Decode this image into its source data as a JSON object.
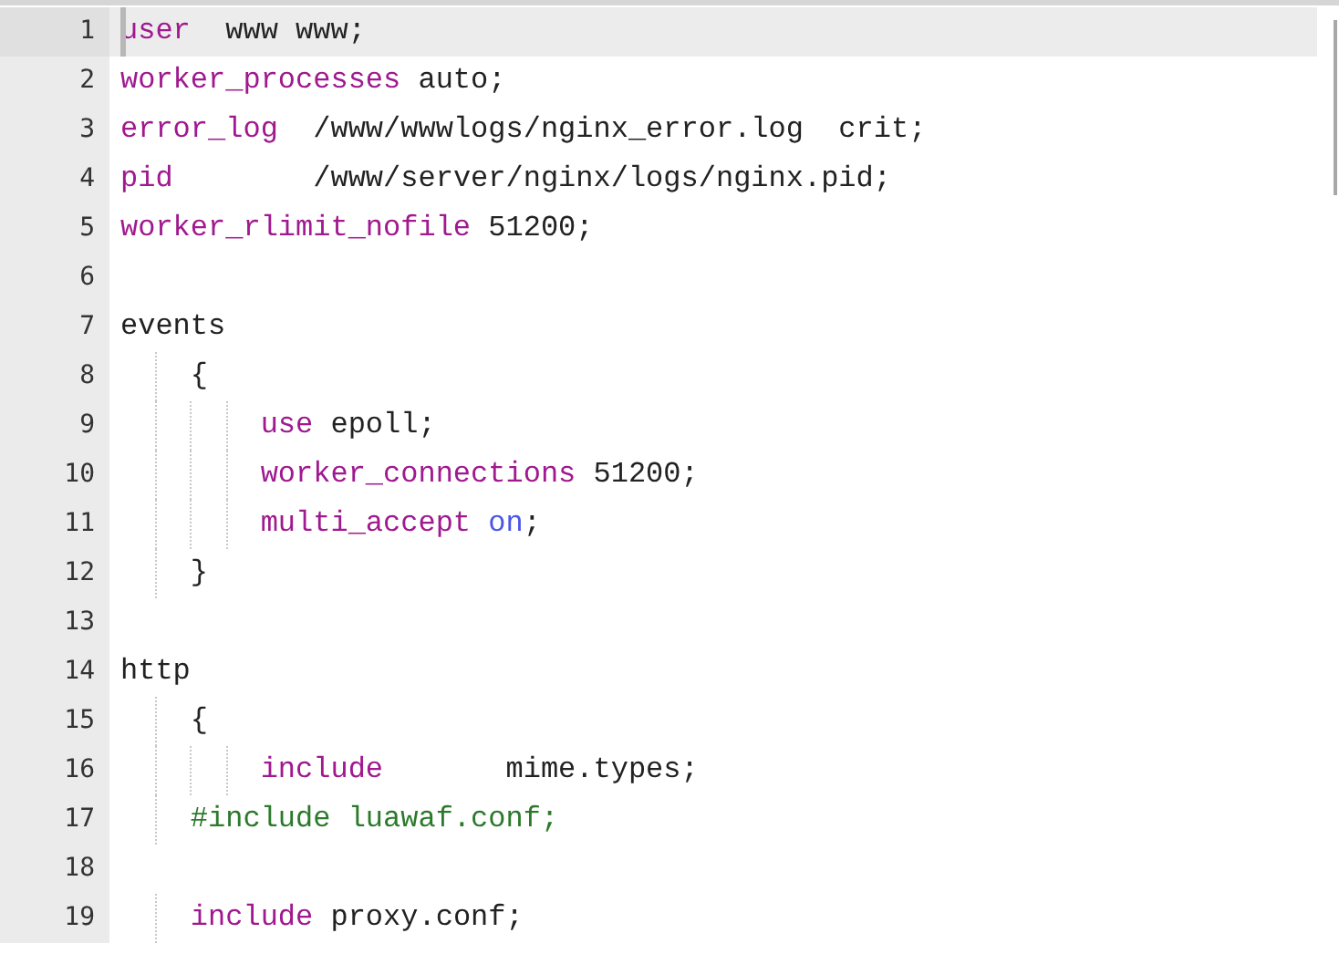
{
  "editor": {
    "lines": [
      {
        "number": "1",
        "selected": true,
        "tokens": [
          {
            "kind": "keyword",
            "text": "user"
          },
          {
            "kind": "plain",
            "text": "  www www;"
          }
        ]
      },
      {
        "number": "2",
        "selected": false,
        "tokens": [
          {
            "kind": "keyword",
            "text": "worker_processes"
          },
          {
            "kind": "plain",
            "text": " auto;"
          }
        ]
      },
      {
        "number": "3",
        "selected": false,
        "tokens": [
          {
            "kind": "keyword",
            "text": "error_log"
          },
          {
            "kind": "plain",
            "text": "  /www/wwwlogs/nginx_error.log  crit;"
          }
        ]
      },
      {
        "number": "4",
        "selected": false,
        "tokens": [
          {
            "kind": "keyword",
            "text": "pid"
          },
          {
            "kind": "plain",
            "text": "        /www/server/nginx/logs/nginx.pid;"
          }
        ]
      },
      {
        "number": "5",
        "selected": false,
        "tokens": [
          {
            "kind": "keyword",
            "text": "worker_rlimit_nofile"
          },
          {
            "kind": "plain",
            "text": " 51200;"
          }
        ]
      },
      {
        "number": "6",
        "selected": false
      },
      {
        "number": "7",
        "selected": false,
        "tokens": [
          {
            "kind": "plain",
            "text": "events"
          }
        ]
      },
      {
        "number": "8",
        "selected": false,
        "tokens": [
          {
            "kind": "plain",
            "text": "    {"
          }
        ]
      },
      {
        "number": "9",
        "selected": false,
        "tokens": [
          {
            "kind": "keyword",
            "text": "        use"
          },
          {
            "kind": "plain",
            "text": " epoll;"
          }
        ]
      },
      {
        "number": "10",
        "selected": false,
        "tokens": [
          {
            "kind": "keyword",
            "text": "        worker_connections"
          },
          {
            "kind": "plain",
            "text": " 51200;"
          }
        ]
      },
      {
        "number": "11",
        "selected": false,
        "tokens": [
          {
            "kind": "keyword",
            "text": "        multi_accept"
          },
          {
            "kind": "value",
            "text": " on"
          },
          {
            "kind": "plain",
            "text": ";"
          }
        ]
      },
      {
        "number": "12",
        "selected": false,
        "tokens": [
          {
            "kind": "plain",
            "text": "    }"
          }
        ]
      },
      {
        "number": "13",
        "selected": false
      },
      {
        "number": "14",
        "selected": false,
        "tokens": [
          {
            "kind": "plain",
            "text": "http"
          }
        ]
      },
      {
        "number": "15",
        "selected": false,
        "tokens": [
          {
            "kind": "plain",
            "text": "    {"
          }
        ]
      },
      {
        "number": "16",
        "selected": false,
        "tokens": [
          {
            "kind": "keyword",
            "text": "        include"
          },
          {
            "kind": "plain",
            "text": "       mime.types;"
          }
        ]
      },
      {
        "number": "17",
        "selected": false,
        "tokens": [
          {
            "kind": "comment",
            "text": "    #include luawaf.conf;"
          }
        ]
      },
      {
        "number": "18",
        "selected": false
      },
      {
        "number": "19",
        "selected": false,
        "tokens": [
          {
            "kind": "keyword",
            "text": "    include"
          },
          {
            "kind": "plain",
            "text": " proxy.conf;"
          }
        ]
      }
    ]
  }
}
